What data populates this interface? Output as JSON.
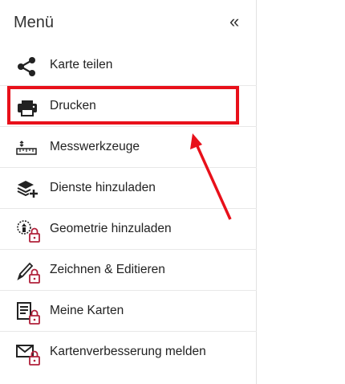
{
  "menu": {
    "title": "Menü",
    "collapse_glyph": "«",
    "items": [
      {
        "label": "Karte teilen",
        "icon": "share-icon",
        "locked": false
      },
      {
        "label": "Drucken",
        "icon": "printer-icon",
        "locked": false
      },
      {
        "label": "Messwerkzeuge",
        "icon": "ruler-icon",
        "locked": false
      },
      {
        "label": "Dienste hinzuladen",
        "icon": "layers-add-icon",
        "locked": false
      },
      {
        "label": "Geometrie hinzuladen",
        "icon": "geometry-icon",
        "locked": true
      },
      {
        "label": "Zeichnen & Editieren",
        "icon": "pencil-icon",
        "locked": true
      },
      {
        "label": "Meine Karten",
        "icon": "my-maps-icon",
        "locked": true
      },
      {
        "label": "Kartenverbesserung melden",
        "icon": "mail-icon",
        "locked": true
      }
    ]
  },
  "annotation": {
    "highlight_color": "#e8101a",
    "lock_color": "#b0203a"
  }
}
